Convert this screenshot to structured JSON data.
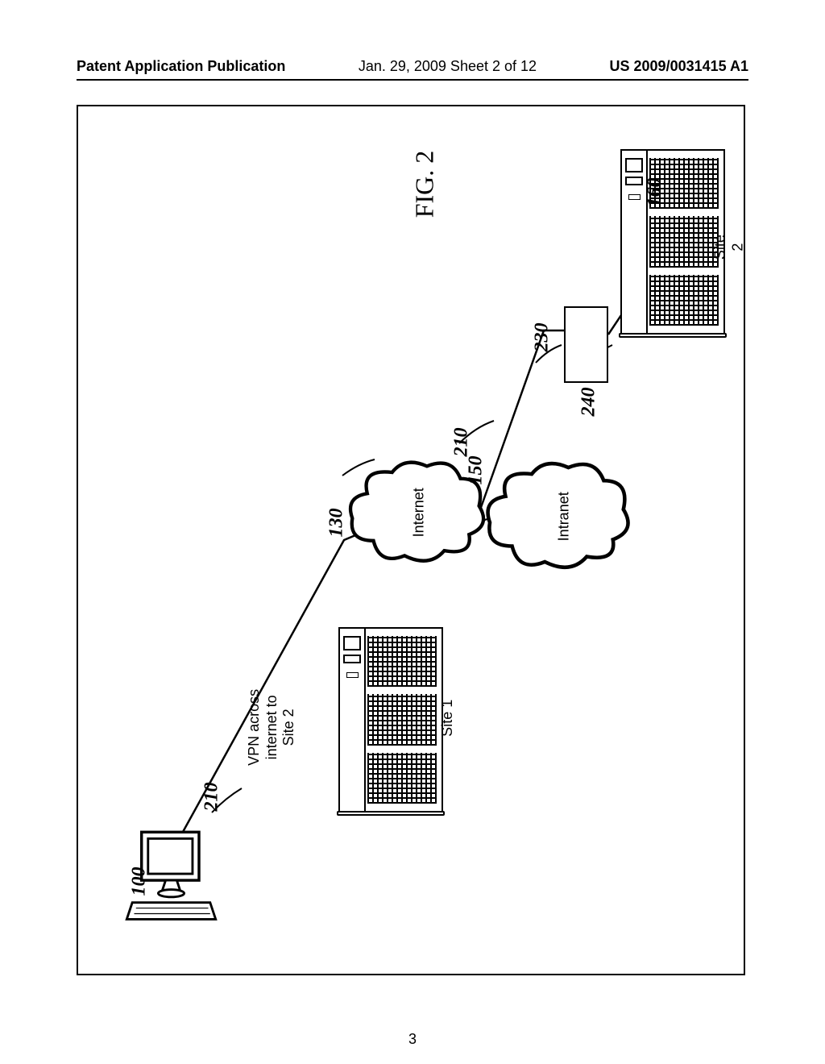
{
  "header": {
    "left": "Patent Application Publication",
    "center": "Jan. 29, 2009  Sheet 2 of 12",
    "right": "US 2009/0031415 A1"
  },
  "figure": {
    "title": "FIG. 2",
    "vpn_label": "VPN across\ninternet to\nSite 2",
    "internet": "Internet",
    "intranet": "Intranet",
    "site1": "Site 1",
    "site2": "Site 2",
    "refs": {
      "workstation": "100",
      "site1_server": "130",
      "intranet_cloud": "150",
      "site2_server": "160",
      "vpn_left": "210",
      "vpn_right": "210",
      "router": "230",
      "link_240": "240"
    }
  },
  "page": "3"
}
